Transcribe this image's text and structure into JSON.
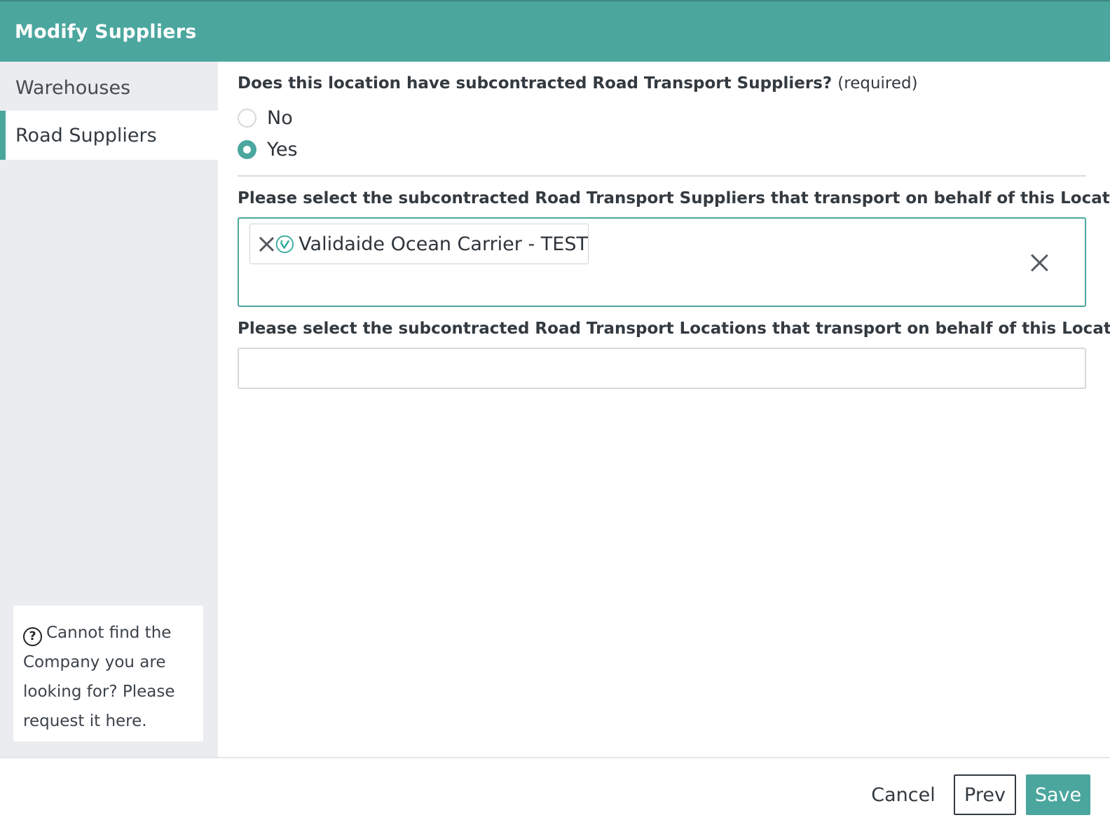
{
  "header": {
    "title": "Modify Suppliers"
  },
  "sidebar": {
    "items": [
      {
        "label": "Warehouses"
      },
      {
        "label": "Road Suppliers"
      }
    ],
    "help_text": "Cannot find the Company you are looking for? Please request it here."
  },
  "form": {
    "question": "Does this location have subcontracted Road Transport Suppliers?",
    "required_marker": "(required)",
    "options": [
      {
        "label": "No",
        "checked": false
      },
      {
        "label": "Yes",
        "checked": true
      }
    ],
    "suppliers_label": "Please select the subcontracted Road Transport Suppliers that transport on behalf of this Location.",
    "selected_suppliers": [
      {
        "name": "Validaide Ocean Carrier - TEST"
      }
    ],
    "locations_label": "Please select the subcontracted Road Transport Locations that transport on behalf of this Location."
  },
  "footer": {
    "cancel_label": "Cancel",
    "prev_label": "Prev",
    "save_label": "Save"
  },
  "colors": {
    "accent": "#4ba69e",
    "sidebar_bg": "#ebecef"
  }
}
